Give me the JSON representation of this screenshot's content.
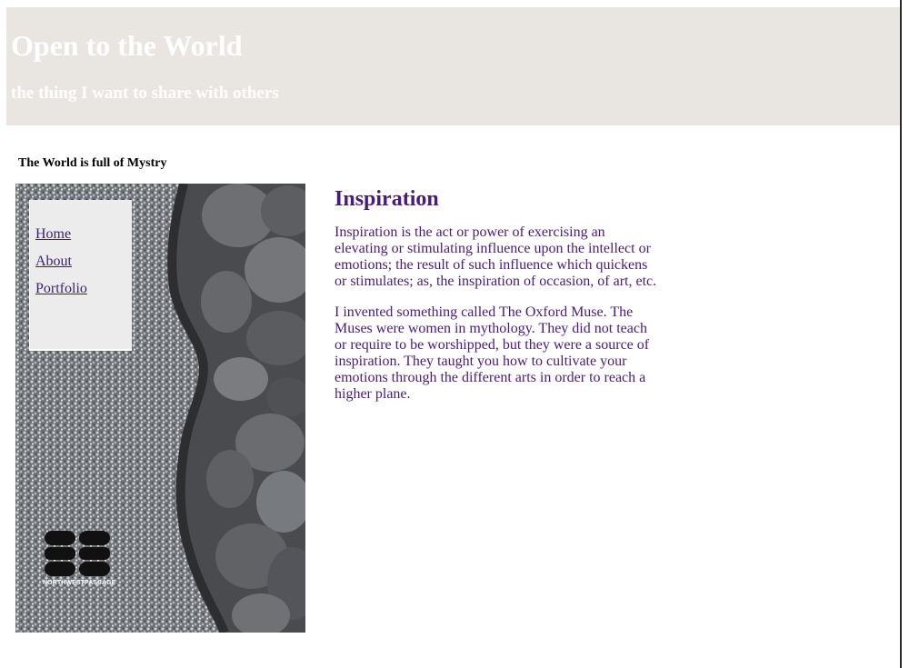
{
  "header": {
    "title": "Open to the World",
    "tagline": "the thing I want to share with others"
  },
  "sidebar": {
    "heading": "The World is full of Mystry",
    "nav": [
      {
        "label": "Home"
      },
      {
        "label": "About"
      },
      {
        "label": "Portfolio"
      }
    ],
    "logo_text": "NORTHWESTPASSAGE"
  },
  "content": {
    "heading": "Inspiration",
    "paragraphs": [
      "Inspiration is the act or power of exercising an elevating or stimulating influence upon the intellect or emotions; the result of such influence which quickens or stimulates; as, the inspiration of occasion, of art, etc.",
      "I invented something called The Oxford Muse. The Muses were women in mythology. They did not teach or require to be worshipped, but they were a source of inspiration. They taught you how to cultivate your emotions through the different arts in order to reach a higher plane."
    ]
  },
  "colors": {
    "header_bg": "#e9e6e2",
    "link": "#3d1e6f",
    "content_text": "#4b1a7d",
    "nav_bg": "#ececec"
  }
}
